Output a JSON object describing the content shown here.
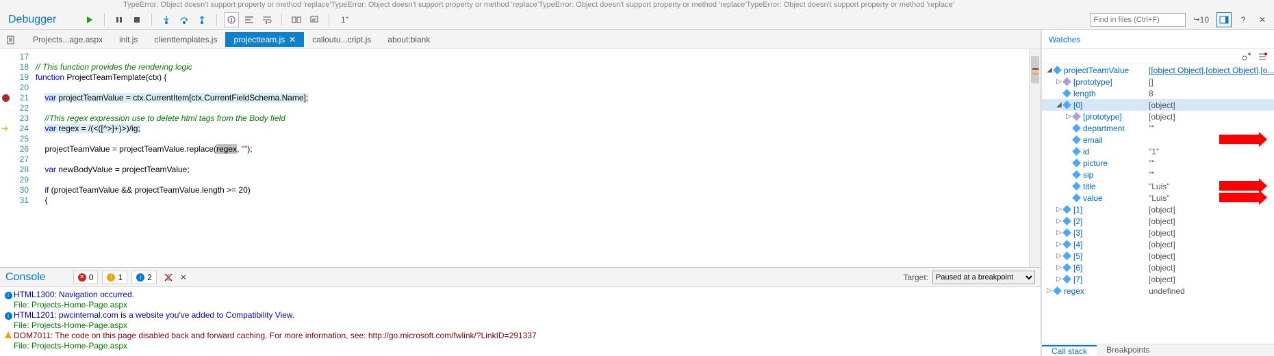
{
  "topstrip": "TypeError: Object doesn't support property or method 'replace'TypeError: Object doesn't support property or method 'replace'TypeError: Object doesn't support property or method 'replace'TypeError: Object doesn't support property or method 'replace'",
  "title": "Debugger",
  "find_placeholder": "Find in files (Ctrl+F)",
  "matchcount": "10",
  "tabs": [
    "Projects...age.aspx",
    "init.js",
    "clienttemplates.js",
    "projectteam.js",
    "calloutu...cript.js",
    "about:blank"
  ],
  "active_tab": 3,
  "lines": {
    "start": 17,
    "rows": [
      {
        "n": 17,
        "t": ""
      },
      {
        "n": 18,
        "t": "// This function provides the rendering logic",
        "cls": "cm"
      },
      {
        "n": 19,
        "t": "function ProjectTeamTemplate(ctx) {"
      },
      {
        "n": 20,
        "t": ""
      },
      {
        "n": 21,
        "t": "    var projectTeamValue = ctx.CurrentItem[ctx.CurrentFieldSchema.Name];",
        "bp": true,
        "hl": true
      },
      {
        "n": 22,
        "t": ""
      },
      {
        "n": 23,
        "t": "    //This regex expression use to delete html tags from the Body field",
        "cls": "cm"
      },
      {
        "n": 24,
        "t": "    var regex = /(<([^>]+)>)/ig;",
        "cur": true,
        "hl": true
      },
      {
        "n": 25,
        "t": ""
      },
      {
        "n": 26,
        "t": "    projectTeamValue = projectTeamValue.replace(regex, \"\");",
        "sel": "regex"
      },
      {
        "n": 27,
        "t": ""
      },
      {
        "n": 28,
        "t": "    var newBodyValue = projectTeamValue;"
      },
      {
        "n": 29,
        "t": ""
      },
      {
        "n": 30,
        "t": "    if (projectTeamValue && projectTeamValue.length >= 20)"
      },
      {
        "n": 31,
        "t": "    {"
      }
    ]
  },
  "console": {
    "title": "Console",
    "badges": [
      {
        "icon": "err",
        "color": "#d01f1f",
        "count": "0"
      },
      {
        "icon": "warn",
        "color": "#f0a30a",
        "count": "1"
      },
      {
        "icon": "info",
        "color": "#0078d7",
        "count": "2"
      }
    ],
    "target_label": "Target:",
    "target_value": "Paused at a breakpoint",
    "rows": [
      {
        "icon": "i",
        "c": "blue",
        "t": "HTML1300: Navigation occurred."
      },
      {
        "icon": "",
        "c": "green",
        "t": "File: Projects-Home-Page.aspx"
      },
      {
        "icon": "i",
        "c": "blue",
        "t": "HTML1201: pwcinternal.com is a website you've added to Compatibility View."
      },
      {
        "icon": "",
        "c": "green",
        "t": "File: Projects-Home-Page.aspx"
      },
      {
        "icon": "w",
        "c": "dkred",
        "t": "DOM7011: The code on this page disabled back and forward caching. For more information, see: http://go.microsoft.com/fwlink/?LinkID=291337"
      },
      {
        "icon": "",
        "c": "green",
        "t": "File: Projects-Home-Page.aspx"
      }
    ]
  },
  "watches": {
    "title": "Watches",
    "rows": [
      {
        "d": 0,
        "exp": "open",
        "n": "projectTeamValue",
        "v": "[[object Object],[object Object],[o...",
        "link": true
      },
      {
        "d": 1,
        "exp": "closed",
        "n": "[prototype]",
        "v": "[]",
        "p": true
      },
      {
        "d": 1,
        "exp": "",
        "n": "length",
        "v": "8"
      },
      {
        "d": 1,
        "exp": "open",
        "n": "[0]",
        "v": "[object]",
        "active": true
      },
      {
        "d": 2,
        "exp": "closed",
        "n": "[prototype]",
        "v": "[object]",
        "p": true
      },
      {
        "d": 2,
        "exp": "",
        "n": "department",
        "v": "\"\""
      },
      {
        "d": 2,
        "exp": "",
        "n": "email",
        "v": "",
        "arrow": true
      },
      {
        "d": 2,
        "exp": "",
        "n": "id",
        "v": "\"1\""
      },
      {
        "d": 2,
        "exp": "",
        "n": "picture",
        "v": "\"\""
      },
      {
        "d": 2,
        "exp": "",
        "n": "sip",
        "v": "\"\""
      },
      {
        "d": 2,
        "exp": "",
        "n": "title",
        "v": "\"Luis\"",
        "arrow": true
      },
      {
        "d": 2,
        "exp": "",
        "n": "value",
        "v": "\"Luis\"",
        "arrow": true
      },
      {
        "d": 1,
        "exp": "closed",
        "n": "[1]",
        "v": "[object]"
      },
      {
        "d": 1,
        "exp": "closed",
        "n": "[2]",
        "v": "[object]"
      },
      {
        "d": 1,
        "exp": "closed",
        "n": "[3]",
        "v": "[object]"
      },
      {
        "d": 1,
        "exp": "closed",
        "n": "[4]",
        "v": "[object]"
      },
      {
        "d": 1,
        "exp": "closed",
        "n": "[5]",
        "v": "[object]"
      },
      {
        "d": 1,
        "exp": "closed",
        "n": "[6]",
        "v": "[object]"
      },
      {
        "d": 1,
        "exp": "closed",
        "n": "[7]",
        "v": "[object]"
      },
      {
        "d": 0,
        "exp": "closed",
        "n": "regex",
        "v": "undefined"
      }
    ],
    "footer_tabs": [
      "Call stack",
      "Breakpoints"
    ],
    "footer_active": 0
  }
}
